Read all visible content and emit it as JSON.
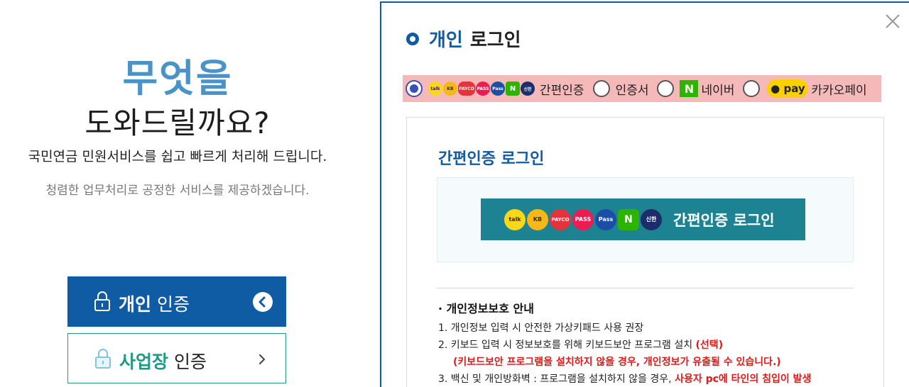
{
  "hero": {
    "line1": "무엇을",
    "line2": "도와드릴까요?",
    "sub1": "국민연금 민원서비스를 쉽고 빠르게 처리해 드립니다.",
    "sub2": "청렴한 업무처리로 공정한 서비스를 제공하겠습니다."
  },
  "auth_buttons": {
    "personal": {
      "strong": "개인",
      "rest": " 인증"
    },
    "business": {
      "strong": "사업장",
      "rest": " 인증"
    }
  },
  "modal": {
    "title_blue": "개인",
    "title_rest": "로그인",
    "login_methods": [
      {
        "label": "간편인증",
        "selected": true
      },
      {
        "label": "인증서",
        "selected": false
      },
      {
        "label": "네이버",
        "selected": false,
        "badge": "N"
      },
      {
        "label": "카카오페이",
        "selected": false,
        "badge": "pay"
      }
    ],
    "simple_auth_title": "간편인증 로그인",
    "simple_auth_button": "간편인증 로그인",
    "provider_icons": [
      "talk",
      "KB",
      "PAYCO",
      "PASS",
      "Pass",
      "N",
      "신한"
    ],
    "privacy": {
      "heading": "· 개인정보보호 안내",
      "l1": "1. 개인정보 입력 시 안전한 가상키패드 사용 권장",
      "l2a": "2. 키보드 입력 시 정보보호를 위해 키보드보안 프로그램 설치 ",
      "l2b": "(선택)",
      "l2c": "(키보드보안 프로그램을 설치하지 않을 경우, 개인정보가 유출될 수 있습니다.)",
      "l3a": "3. 백신 및 개인방화벽 : 프로그램을 설치하지 않을 경우, ",
      "l3b": "사용자 pc에 타인의 침입이 발생"
    }
  },
  "colors": {
    "primary_blue": "#0f5ba4",
    "hero_blue": "#4a93c8",
    "teal": "#1f9a87",
    "button_teal": "#1d8291",
    "highlight": "#f5b9b9",
    "warning_red": "#e01a1a"
  },
  "icons": {
    "lock": "lock-icon",
    "chevron_circle": "chevron-left-circle-icon",
    "chevron_right": "chevron-right-icon",
    "close": "close-icon"
  }
}
